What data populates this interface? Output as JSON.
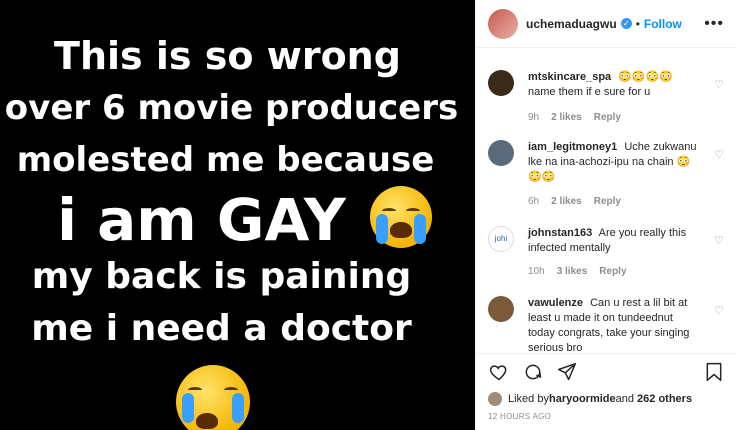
{
  "post": {
    "lines": [
      "This is so wrong",
      "over 6 movie producers",
      "molested me because",
      "i am GAY",
      "my back is paining",
      "me i need a doctor"
    ]
  },
  "header": {
    "username": "uchemaduagwu",
    "dot": "•",
    "follow": "Follow"
  },
  "comments": [
    {
      "user": "mtskincare_spa",
      "text": "😳😳😳😳 name them if e sure for u",
      "time": "9h",
      "likes": "2 likes",
      "reply": "Reply",
      "avatar_color": "#3a2a1a"
    },
    {
      "user": "iam_legitmoney1",
      "text": "Uche zukwanu lke na ina-achozi-ipu na chain 😳😳😳",
      "time": "6h",
      "likes": "2 likes",
      "reply": "Reply",
      "avatar_color": "#5a6a7a"
    },
    {
      "user": "johnstan163",
      "text": "Are you really this infected mentally",
      "time": "10h",
      "likes": "3 likes",
      "reply": "Reply",
      "avatar_color": "#ffffff",
      "avatar_text": "johi"
    },
    {
      "user": "vawulenze",
      "text": "Can u rest a lil bit at least u made it on tundeednut today congrats, take your singing serious bro",
      "time": "",
      "likes": "",
      "reply": "",
      "avatar_color": "#7a5a3a"
    }
  ],
  "likes": {
    "prefix": "Liked by ",
    "user": "haryoormide",
    "middle": " and ",
    "others": "262 others"
  },
  "timestamp": "12 HOURS AGO"
}
